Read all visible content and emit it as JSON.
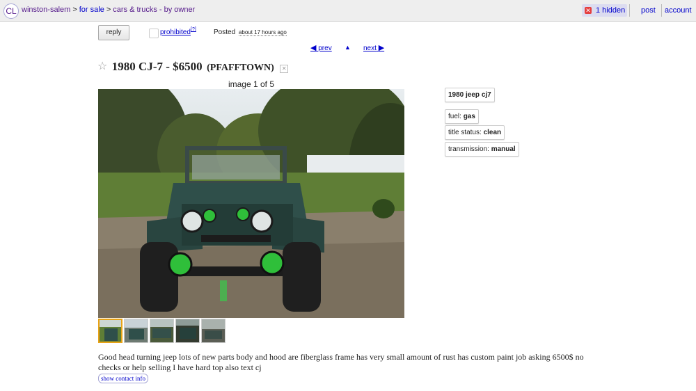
{
  "header": {
    "logo": "CL",
    "breadcrumbs": [
      "winston-salem",
      "for sale",
      "cars & trucks - by owner"
    ],
    "hidden_label": "1 hidden",
    "post_label": "post",
    "account_label": "account"
  },
  "actions": {
    "reply_label": "reply",
    "prohibited_label": "prohibited",
    "help_label": "[?]",
    "posted_label": "Posted",
    "posted_time": "about 17 hours ago"
  },
  "nav": {
    "prev_label": "prev",
    "up_label": "▲",
    "next_label": "next"
  },
  "listing": {
    "title": "1980 CJ-7 - $6500",
    "location": "(PFAFFTOWN)",
    "image_counter": "image 1 of 5",
    "thumbnail_count": 5,
    "description": "Good head turning jeep lots of new parts body and hood are fiberglass frame has very small amount of rust has custom paint job asking 6500$ no checks or help selling I have hard top also text cj",
    "contact_label": "show contact info"
  },
  "attributes": {
    "model": "1980 jeep cj7",
    "fuel_label": "fuel:",
    "fuel_value": "gas",
    "title_status_label": "title status:",
    "title_status_value": "clean",
    "transmission_label": "transmission:",
    "transmission_value": "manual"
  },
  "colors": {
    "link": "#0000cc",
    "visited": "#551a8b",
    "thumb_active_border": "#e8a317",
    "jeep_body": "#2f4f4a",
    "accent_green": "#2fbf3a"
  }
}
